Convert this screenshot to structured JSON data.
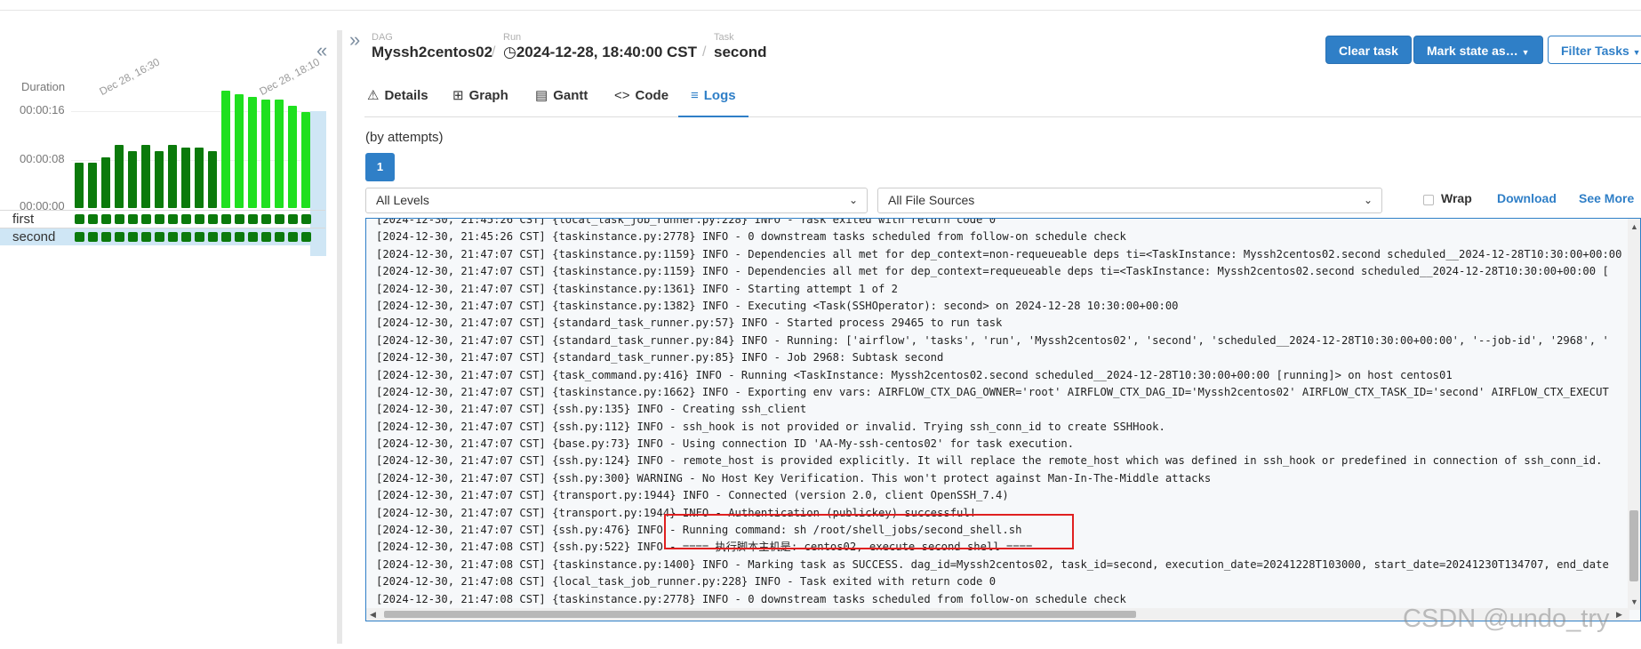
{
  "grid": {
    "duration_label": "Duration",
    "y_ticks": [
      "00:00:16",
      "00:00:08",
      "00:00:00"
    ],
    "date_labels": [
      "Dec 28, 16:30",
      "Dec 28, 18:10"
    ],
    "bar_values": [
      7.5,
      7.5,
      8.5,
      10.5,
      9.5,
      10.5,
      9.5,
      10.5,
      10,
      10,
      9.5,
      19.5,
      19,
      18.5,
      18,
      18,
      17,
      16
    ],
    "bar_colors": [
      "#0b7a0b",
      "#0b7a0b",
      "#0b7a0b",
      "#0b7a0b",
      "#0b7a0b",
      "#0b7a0b",
      "#0b7a0b",
      "#0b7a0b",
      "#0b7a0b",
      "#0b7a0b",
      "#0b7a0b",
      "#1fe01f",
      "#1fe01f",
      "#1fe01f",
      "#1fe01f",
      "#1fe01f",
      "#1fe01f",
      "#1fe01f"
    ],
    "tasks": [
      "first",
      "second"
    ],
    "run_count": 18
  },
  "breadcrumb": {
    "dag_label": "DAG",
    "dag_value": "Myssh2centos02",
    "run_label": "Run",
    "run_value": "2024-12-28, 18:40:00 CST",
    "task_label": "Task",
    "task_value": "second",
    "separator": "/"
  },
  "toolbar": {
    "clear_task": "Clear task",
    "mark_state": "Mark state as…",
    "filter_tasks": "Filter Tasks"
  },
  "tabs": [
    {
      "icon": "⚠",
      "label": "Details"
    },
    {
      "icon": "⊞",
      "label": "Graph"
    },
    {
      "icon": "▤",
      "label": "Gantt"
    },
    {
      "icon": "<>",
      "label": "Code"
    },
    {
      "icon": "≡",
      "label": "Logs"
    }
  ],
  "logs": {
    "attempts_label": "(by attempts)",
    "attempt": "1",
    "level_select": "All Levels",
    "source_select": "All File Sources",
    "wrap_label": "Wrap",
    "download_label": "Download",
    "see_more_label": "See More",
    "lines": [
      "[2024-12-30, 21:45:26 CST] {local_task_job_runner.py:228} INFO - Task exited with return code 0",
      "[2024-12-30, 21:45:26 CST] {taskinstance.py:2778} INFO - 0 downstream tasks scheduled from follow-on schedule check",
      "[2024-12-30, 21:47:07 CST] {taskinstance.py:1159} INFO - Dependencies all met for dep_context=non-requeueable deps ti=<TaskInstance: Myssh2centos02.second scheduled__2024-12-28T10:30:00+00:00",
      "[2024-12-30, 21:47:07 CST] {taskinstance.py:1159} INFO - Dependencies all met for dep_context=requeueable deps ti=<TaskInstance: Myssh2centos02.second scheduled__2024-12-28T10:30:00+00:00 [",
      "[2024-12-30, 21:47:07 CST] {taskinstance.py:1361} INFO - Starting attempt 1 of 2",
      "[2024-12-30, 21:47:07 CST] {taskinstance.py:1382} INFO - Executing <Task(SSHOperator): second> on 2024-12-28 10:30:00+00:00",
      "[2024-12-30, 21:47:07 CST] {standard_task_runner.py:57} INFO - Started process 29465 to run task",
      "[2024-12-30, 21:47:07 CST] {standard_task_runner.py:84} INFO - Running: ['airflow', 'tasks', 'run', 'Myssh2centos02', 'second', 'scheduled__2024-12-28T10:30:00+00:00', '--job-id', '2968', '",
      "[2024-12-30, 21:47:07 CST] {standard_task_runner.py:85} INFO - Job 2968: Subtask second",
      "[2024-12-30, 21:47:07 CST] {task_command.py:416} INFO - Running <TaskInstance: Myssh2centos02.second scheduled__2024-12-28T10:30:00+00:00 [running]> on host centos01",
      "[2024-12-30, 21:47:07 CST] {taskinstance.py:1662} INFO - Exporting env vars: AIRFLOW_CTX_DAG_OWNER='root' AIRFLOW_CTX_DAG_ID='Myssh2centos02' AIRFLOW_CTX_TASK_ID='second' AIRFLOW_CTX_EXECUT",
      "[2024-12-30, 21:47:07 CST] {ssh.py:135} INFO - Creating ssh_client",
      "[2024-12-30, 21:47:07 CST] {ssh.py:112} INFO - ssh_hook is not provided or invalid. Trying ssh_conn_id to create SSHHook.",
      "[2024-12-30, 21:47:07 CST] {base.py:73} INFO - Using connection ID 'AA-My-ssh-centos02' for task execution.",
      "[2024-12-30, 21:47:07 CST] {ssh.py:124} INFO - remote_host is provided explicitly. It will replace the remote_host which was defined in ssh_hook or predefined in connection of ssh_conn_id.",
      "[2024-12-30, 21:47:07 CST] {ssh.py:300} WARNING - No Host Key Verification. This won't protect against Man-In-The-Middle attacks",
      "[2024-12-30, 21:47:07 CST] {transport.py:1944} INFO - Connected (version 2.0, client OpenSSH_7.4)",
      "[2024-12-30, 21:47:07 CST] {transport.py:1944} INFO - Authentication (publickey) successful!",
      "[2024-12-30, 21:47:07 CST] {ssh.py:476} INFO - Running command: sh /root/shell_jobs/second_shell.sh",
      "[2024-12-30, 21:47:08 CST] {ssh.py:522} INFO - ==== 执行脚本主机是: centos02, execute second shell ====",
      "[2024-12-30, 21:47:08 CST] {taskinstance.py:1400} INFO - Marking task as SUCCESS. dag_id=Myssh2centos02, task_id=second, execution_date=20241228T103000, start_date=20241230T134707, end_date",
      "[2024-12-30, 21:47:08 CST] {local_task_job_runner.py:228} INFO - Task exited with return code 0",
      "[2024-12-30, 21:47:08 CST] {taskinstance.py:2778} INFO - 0 downstream tasks scheduled from follow-on schedule check"
    ]
  },
  "watermark": "CSDN @undo_try",
  "colors": {
    "accent": "#2f7fc7",
    "success_dark": "#0b7a0b",
    "success_light": "#1fe01f",
    "highlight_box": "#e02020"
  }
}
